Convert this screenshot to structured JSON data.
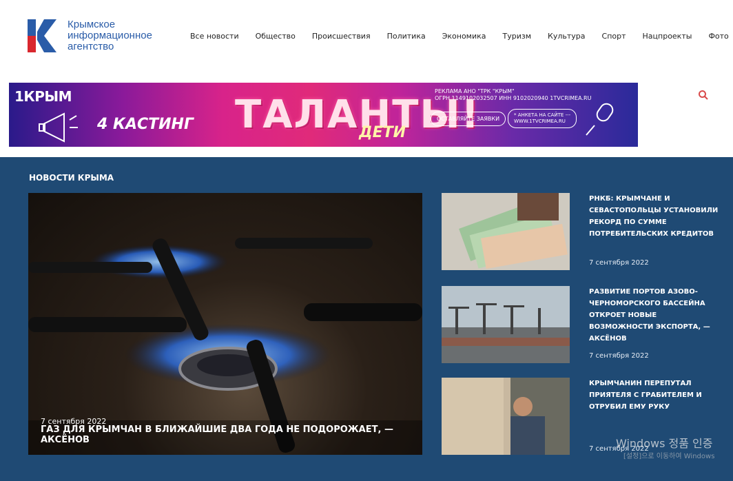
{
  "header": {
    "logo_lines": [
      "Крымское",
      "информационное",
      "агентство"
    ],
    "nav": [
      "Все новости",
      "Общество",
      "Происшествия",
      "Политика",
      "Экономика",
      "Туризм",
      "Культура",
      "Спорт",
      "Нацпроекты",
      "Фото"
    ]
  },
  "banner": {
    "brand": "1КРЫМ",
    "casting": "4 КАСТИНГ",
    "title": "ТАЛАНТЫ!",
    "subtitle": "ДЕТИ",
    "ad_line1": "РЕКЛАМА АНО \"ТРК \"КРЫМ\"",
    "ad_line2": "ОГРН 1149102032507 ИНН 9102020940 1TVCRIMEA.RU",
    "apply_button": "ОСТАВЛЯЙТЕ ЗАЯВКИ",
    "site_button_line1": "* АНКЕТА НА САЙТЕ ---",
    "site_button_line2": "WWW.1TVCRIMEA.RU"
  },
  "colors": {
    "brand_blue": "#2a5ca8",
    "brand_red": "#d9272e",
    "news_bg": "#1f4a74",
    "search_icon": "#d94a4a"
  },
  "news": {
    "section_title": "НОВОСТИ КРЫМА",
    "main": {
      "date": "7 сентября 2022",
      "headline": "ГАЗ ДЛЯ КРЫМЧАН В БЛИЖАЙШИЕ ДВА ГОДА НЕ ПОДОРОЖАЕТ, — АКСЁНОВ"
    },
    "side": [
      {
        "title": "РНКБ: КРЫМЧАНЕ И СЕВАСТОПОЛЬЦЫ УСТАНОВИЛИ РЕКОРД ПО СУММЕ ПОТРЕБИТЕЛЬСКИХ КРЕДИТОВ",
        "date": "7 сентября 2022"
      },
      {
        "title": "РАЗВИТИЕ ПОРТОВ АЗОВО-ЧЕРНОМОРСКОГО БАССЕЙНА ОТКРОЕТ НОВЫЕ ВОЗМОЖНОСТИ ЭКСПОРТА, — АКСЁНОВ",
        "date": "7 сентября 2022"
      },
      {
        "title": "КРЫМЧАНИН ПЕРЕПУТАЛ ПРИЯТЕЛЯ С ГРАБИТЕЛЕМ И ОТРУБИЛ ЕМУ РУКУ",
        "date": "7 сентября 2022"
      }
    ]
  },
  "overlay": {
    "windows_line1": "Windows 정품 인증",
    "windows_line2": "[설정]으로 이동하여 Windows"
  }
}
